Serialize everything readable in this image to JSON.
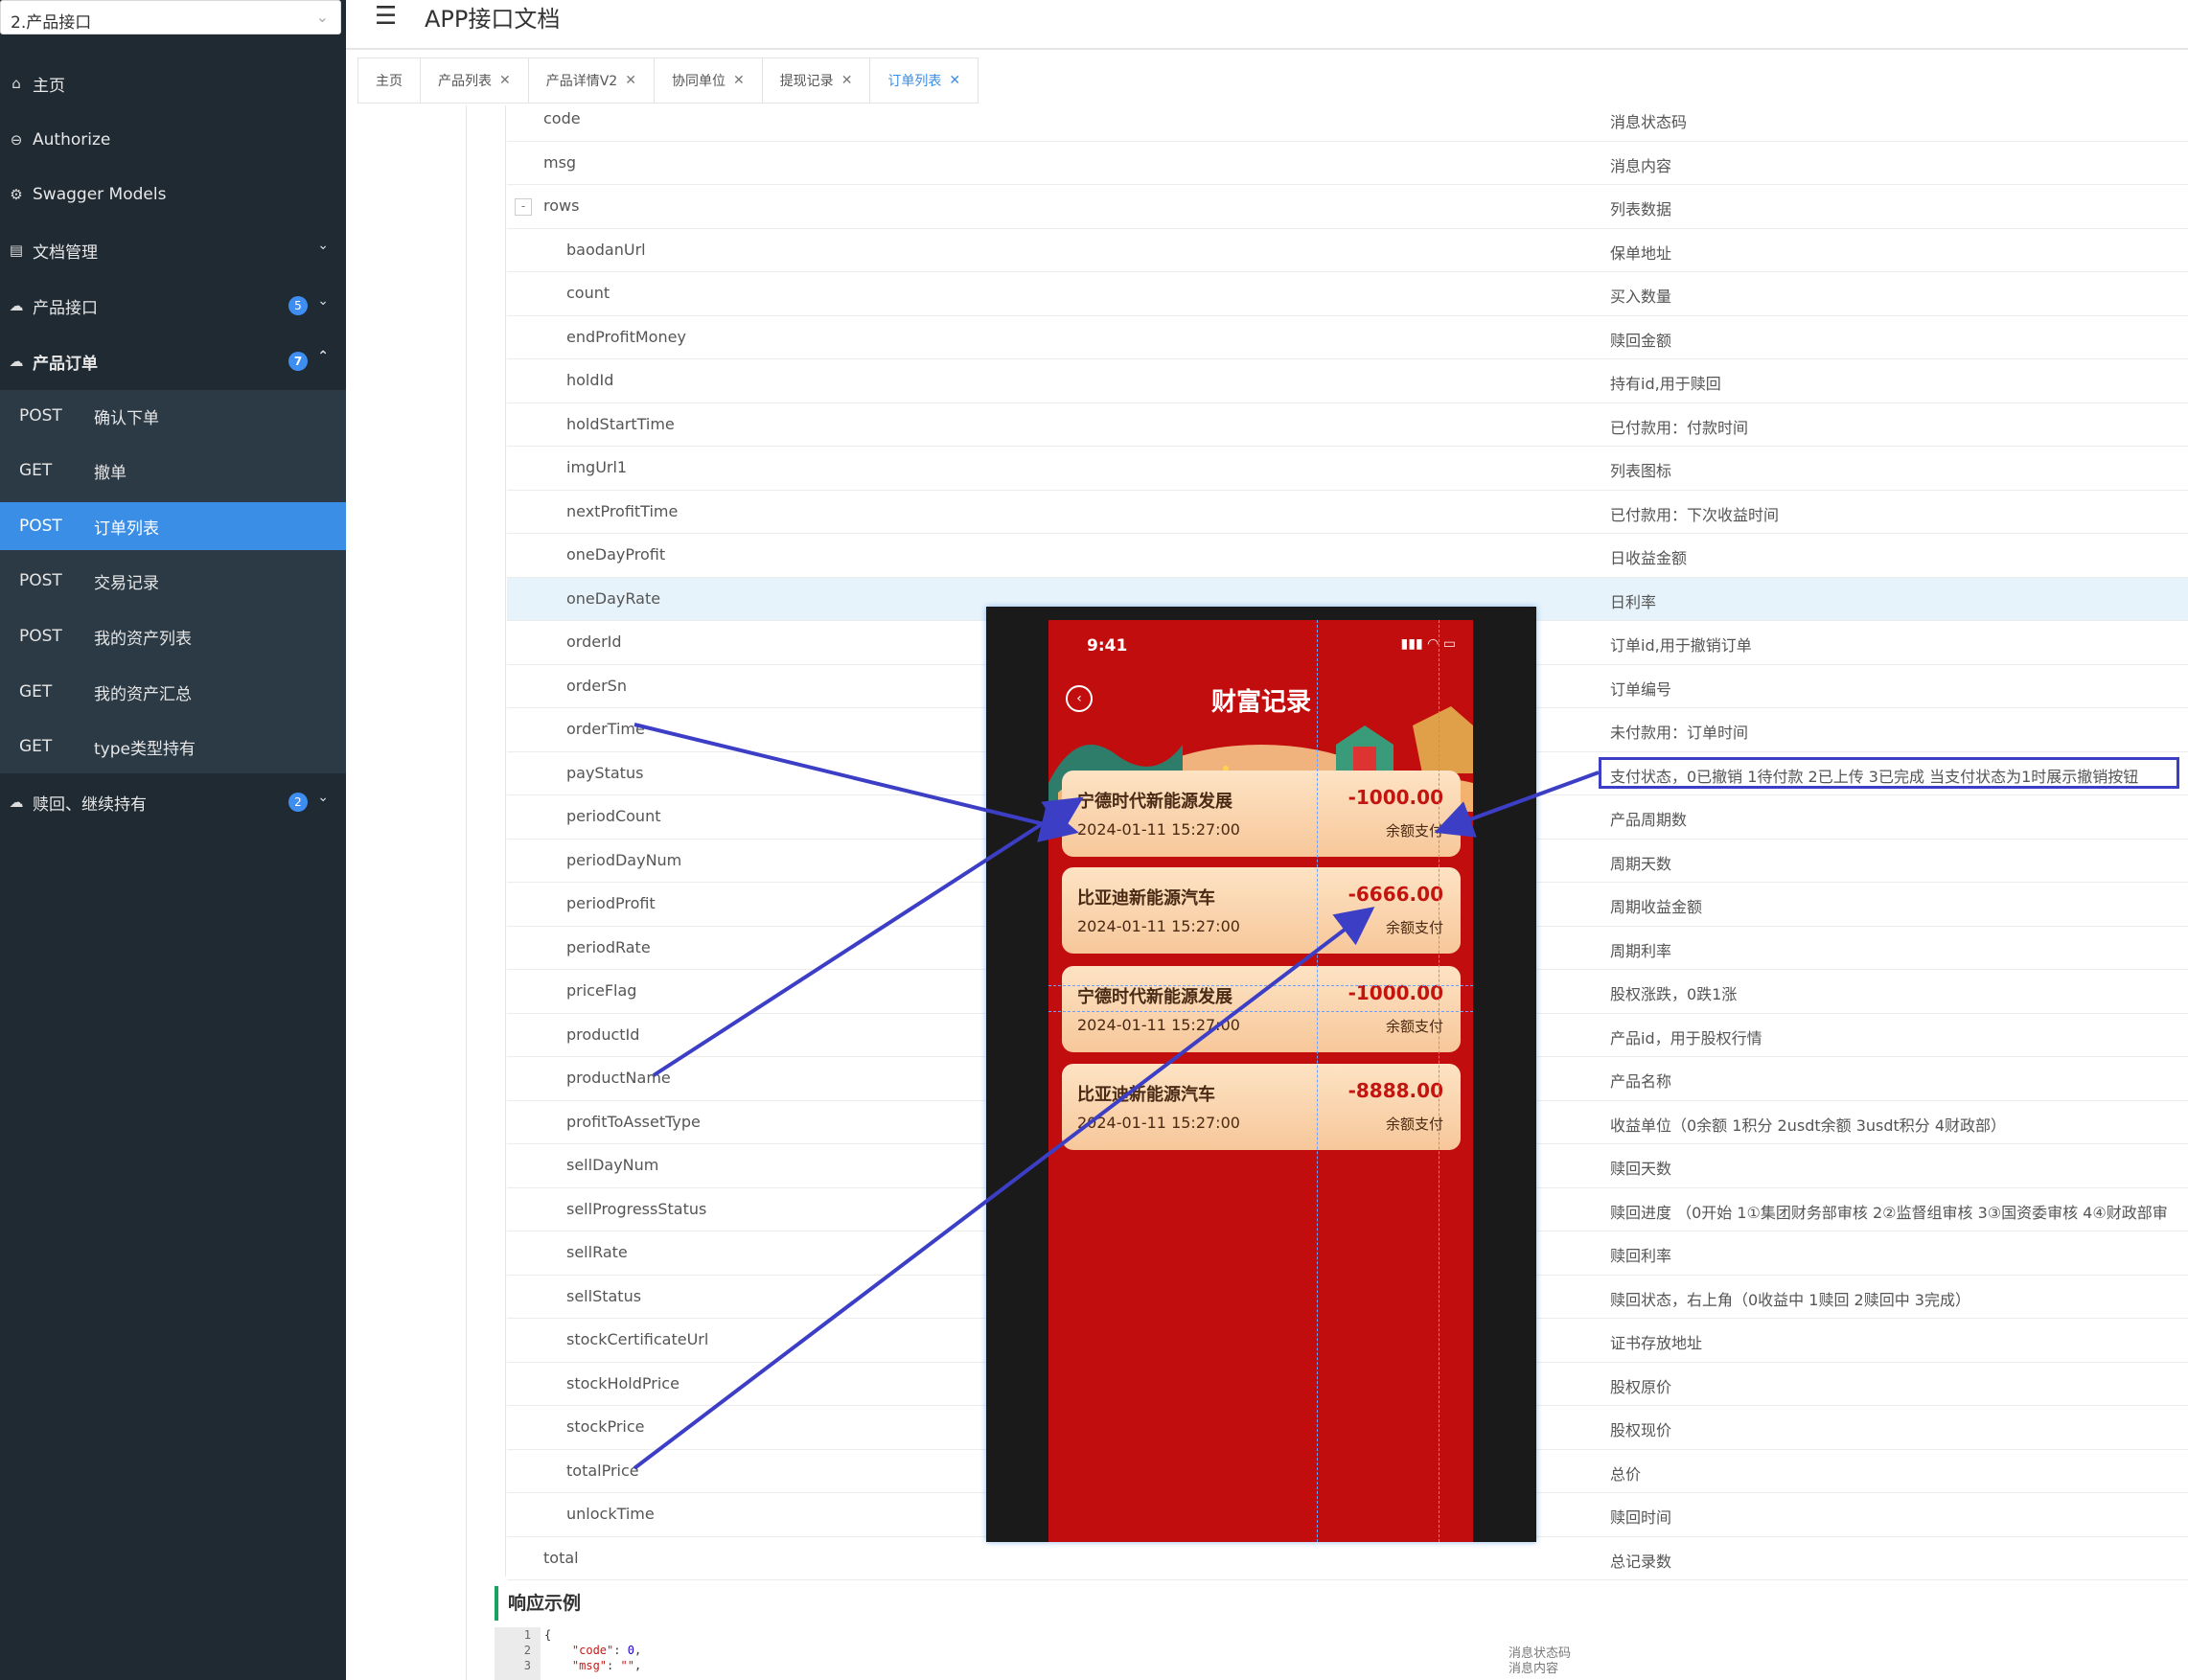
{
  "sidebar": {
    "service_select": "2.产品接口",
    "nav": [
      {
        "label": "主页",
        "icon": "home-icon"
      },
      {
        "label": "Authorize",
        "icon": "lock-icon"
      },
      {
        "label": "Swagger Models",
        "icon": "gear-icon"
      },
      {
        "label": "文档管理",
        "icon": "doc-icon"
      },
      {
        "label": "产品接口",
        "icon": "cloud-icon",
        "badge": "5"
      },
      {
        "label": "产品订单",
        "icon": "cloud-icon",
        "badge": "7"
      }
    ],
    "sub_items": [
      {
        "method": "POST",
        "label": "确认下单"
      },
      {
        "method": "GET",
        "label": "撤单"
      },
      {
        "method": "POST",
        "label": "订单列表"
      },
      {
        "method": "POST",
        "label": "交易记录"
      },
      {
        "method": "POST",
        "label": "我的资产列表"
      },
      {
        "method": "GET",
        "label": "我的资产汇总"
      },
      {
        "method": "GET",
        "label": "type类型持有"
      }
    ],
    "last_nav": {
      "label": "赎回、继续持有",
      "icon": "cloud-icon",
      "badge": "2"
    }
  },
  "header": {
    "title": "APP接口文档"
  },
  "tabs": [
    "主页",
    "产品列表",
    "产品详情V2",
    "协同单位",
    "提现记录",
    "订单列表"
  ],
  "params": [
    {
      "name": "code",
      "desc": "消息状态码"
    },
    {
      "name": "msg",
      "desc": "消息内容"
    },
    {
      "name": "rows",
      "desc": "列表数据",
      "toggle": "-"
    },
    {
      "name": "baodanUrl",
      "desc": "保单地址"
    },
    {
      "name": "count",
      "desc": "买入数量"
    },
    {
      "name": "endProfitMoney",
      "desc": "赎回金额"
    },
    {
      "name": "holdId",
      "desc": "持有id,用于赎回"
    },
    {
      "name": "holdStartTime",
      "desc": "已付款用：付款时间"
    },
    {
      "name": "imgUrl1",
      "desc": "列表图标"
    },
    {
      "name": "nextProfitTime",
      "desc": "已付款用：下次收益时间"
    },
    {
      "name": "oneDayProfit",
      "desc": "日收益金额"
    },
    {
      "name": "oneDayRate",
      "desc": "日利率"
    },
    {
      "name": "orderId",
      "desc": "订单id,用于撤销订单"
    },
    {
      "name": "orderSn",
      "desc": "订单编号"
    },
    {
      "name": "orderTime",
      "desc": "未付款用：订单时间"
    },
    {
      "name": "payStatus",
      "desc": "支付状态，0已撤销 1待付款 2已上传 3已完成 当支付状态为1时展示撤销按钮"
    },
    {
      "name": "periodCount",
      "desc": "产品周期数"
    },
    {
      "name": "periodDayNum",
      "desc": "周期天数"
    },
    {
      "name": "periodProfit",
      "desc": "周期收益金额"
    },
    {
      "name": "periodRate",
      "desc": "周期利率"
    },
    {
      "name": "priceFlag",
      "desc": "股权涨跌，0跌1涨"
    },
    {
      "name": "productId",
      "desc": "产品id，用于股权行情"
    },
    {
      "name": "productName",
      "desc": "产品名称"
    },
    {
      "name": "profitToAssetType",
      "desc": "收益单位（0余额 1积分 2usdt余额 3usdt积分 4财政部）"
    },
    {
      "name": "sellDayNum",
      "desc": "赎回天数"
    },
    {
      "name": "sellProgressStatus",
      "desc": "赎回进度 （0开始 1①集团财务部审核 2②监督组审核 3③国资委审核 4④财政部审"
    },
    {
      "name": "sellRate",
      "desc": "赎回利率"
    },
    {
      "name": "sellStatus",
      "desc": "赎回状态，右上角（0收益中 1赎回 2赎回中 3完成）"
    },
    {
      "name": "stockCertificateUrl",
      "desc": "证书存放地址"
    },
    {
      "name": "stockHoldPrice",
      "desc": "股权原价"
    },
    {
      "name": "stockPrice",
      "desc": "股权现价"
    },
    {
      "name": "totalPrice",
      "desc": "总价"
    },
    {
      "name": "unlockTime",
      "desc": "赎回时间"
    },
    {
      "name": "total",
      "desc": "总记录数"
    }
  ],
  "response_example": {
    "heading": "响应示例",
    "line_numbers": [
      "1",
      "2",
      "3"
    ],
    "line1": "{",
    "line2_key": "\"code\"",
    "line2_val": "0",
    "line3_key": "\"msg\"",
    "line3_val": "\"\"",
    "note1": "消息状态码",
    "note2": "消息内容"
  },
  "phone": {
    "time": "9:41",
    "title": "财富记录",
    "cards": [
      {
        "name": "宁德时代新能源发展",
        "date": "2024-01-11 15:27:00",
        "amount": "-1000.00",
        "pay": "余额支付"
      },
      {
        "name": "比亚迪新能源汽车",
        "date": "2024-01-11 15:27:00",
        "amount": "-6666.00",
        "pay": "余额支付"
      },
      {
        "name": "宁德时代新能源发展",
        "date": "2024-01-11 15:27:00",
        "amount": "-1000.00",
        "pay": "余额支付"
      },
      {
        "name": "比亚迪新能源汽车",
        "date": "2024-01-11 15:27:00",
        "amount": "-8888.00",
        "pay": "余额支付"
      }
    ]
  },
  "colors": {
    "sidebar_bg": "#1f2a33",
    "active_blue": "#3a8ee6",
    "annotation": "#3c3fc5",
    "phone_red": "#c10d0d"
  }
}
